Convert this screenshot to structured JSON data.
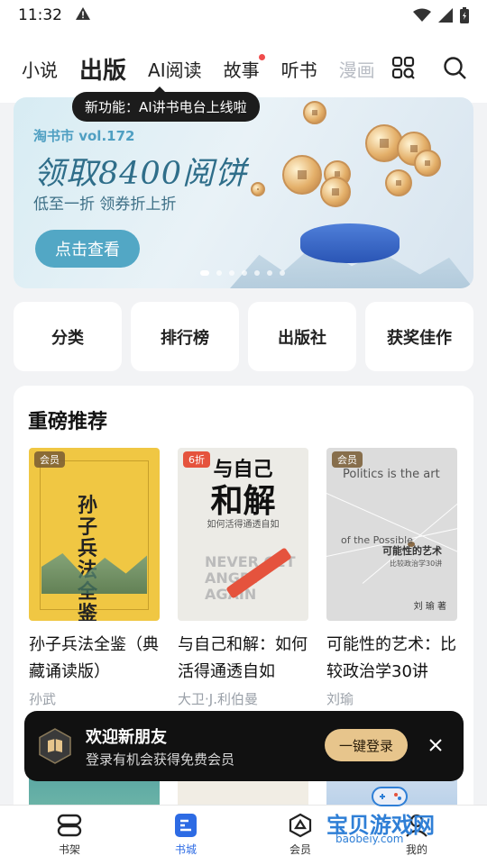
{
  "status_bar": {
    "time": "11:32",
    "warning_icon": "warning-triangle-icon",
    "wifi_icon": "wifi-icon",
    "signal_icon": "signal-icon",
    "battery_icon": "battery-icon"
  },
  "top_nav": {
    "tabs": [
      {
        "label": "小说",
        "active": false,
        "dot": false
      },
      {
        "label": "出版",
        "active": true,
        "dot": false
      },
      {
        "label": "AI阅读",
        "active": false,
        "dot": false
      },
      {
        "label": "故事",
        "active": false,
        "dot": true
      },
      {
        "label": "听书",
        "active": false,
        "dot": false
      },
      {
        "label": "漫画",
        "active": false,
        "dot": false
      }
    ],
    "grid_icon": "grid-icon",
    "search_icon": "search-icon",
    "tooltip": "新功能：AI讲书电台上线啦"
  },
  "banner": {
    "brand": "淘书市 vol.172",
    "headline": "领取8400阅饼",
    "subtitle": "低至一折 领券折上折",
    "cta": "点击查看",
    "page_count": 7,
    "current_page": 0
  },
  "quick_links": [
    "分类",
    "排行榜",
    "出版社",
    "获奖佳作"
  ],
  "recommend": {
    "title": "重磅推荐",
    "books": [
      {
        "title": "孙子兵法全鉴（典藏诵读版）",
        "author": "孙武",
        "badge": "会员",
        "cover_title": "孙子兵法全鉴"
      },
      {
        "title": "与自己和解：如何活得通透自如",
        "author": "大卫·J.利伯曼",
        "badge": "6折",
        "cover_title_1": "与自己",
        "cover_title_2": "和解",
        "cover_sub": "如何活得通透自如",
        "cover_en": "NEVER GET ANGRY AGAIN"
      },
      {
        "title": "可能性的艺术：比较政治学30讲",
        "author": "刘瑜",
        "badge": "会员",
        "cover_en_1": "Politics is the art",
        "cover_en_2": "of the Possible",
        "cover_zh": "可能性的艺术",
        "cover_zh_sub": "比较政治学30讲",
        "cover_author": "刘 瑜 著"
      }
    ]
  },
  "toast": {
    "title": "欢迎新朋友",
    "message": "登录有机会获得免费会员",
    "button": "一键登录",
    "close_icon": "close-icon"
  },
  "bottom_nav": [
    {
      "label": "书架",
      "icon": "bookshelf-icon",
      "active": false
    },
    {
      "label": "书城",
      "icon": "bookstore-icon",
      "active": true
    },
    {
      "label": "会员",
      "icon": "member-icon",
      "active": false
    },
    {
      "label": "我的",
      "icon": "profile-icon",
      "active": false
    }
  ],
  "watermark": {
    "cn": "宝贝游戏网",
    "url": "baobeiy.com"
  },
  "colors": {
    "accent": "#2d6be4",
    "banner_cta": "#52a7c5",
    "login_button": "#e7c58c",
    "sale_badge": "#e5533d"
  }
}
